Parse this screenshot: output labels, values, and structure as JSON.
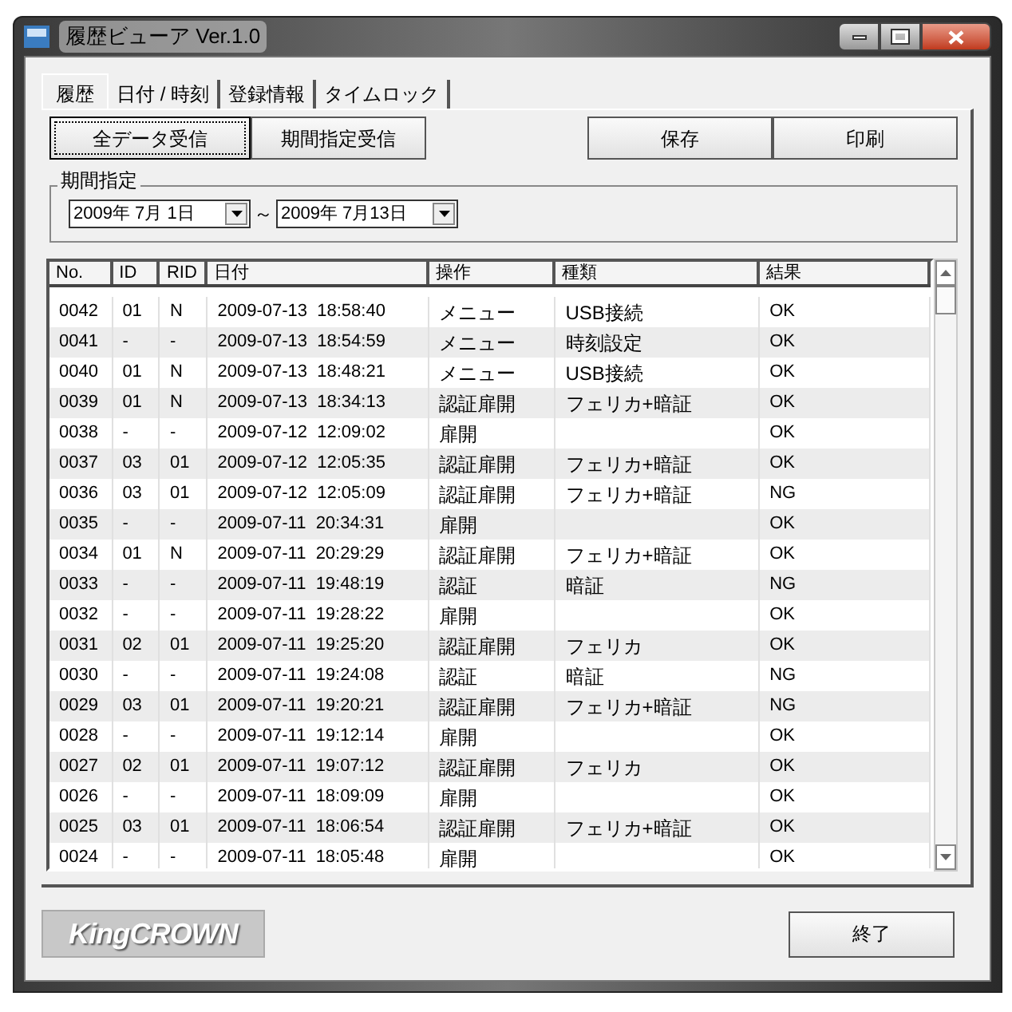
{
  "window": {
    "title": "履歴ビューア Ver.1.0"
  },
  "tabs": [
    {
      "label": "履歴",
      "selected": true
    },
    {
      "label": "日付 / 時刻",
      "selected": false
    },
    {
      "label": "登録情報",
      "selected": false
    },
    {
      "label": "タイムロック",
      "selected": false
    }
  ],
  "left_buttons": [
    {
      "label": "全データ受信",
      "selected": true
    },
    {
      "label": "期間指定受信",
      "selected": false
    }
  ],
  "right_buttons": [
    "保存",
    "印刷"
  ],
  "period": {
    "title": "期間指定",
    "from": "2009年 7月 1日",
    "separator": "～",
    "to": "2009年 7月13日"
  },
  "table": {
    "columns": [
      "No.",
      "ID",
      "RID",
      "日付",
      "操作",
      "種類",
      "結果"
    ],
    "rows": [
      [
        "0042",
        "01",
        "N",
        "2009-07-13  18:58:40",
        "メニュー",
        "USB接続",
        "OK"
      ],
      [
        "0041",
        "-",
        "-",
        "2009-07-13  18:54:59",
        "メニュー",
        "時刻設定",
        "OK"
      ],
      [
        "0040",
        "01",
        "N",
        "2009-07-13  18:48:21",
        "メニュー",
        "USB接続",
        "OK"
      ],
      [
        "0039",
        "01",
        "N",
        "2009-07-13  18:34:13",
        "認証扉開",
        "フェリカ+暗証",
        "OK"
      ],
      [
        "0038",
        "-",
        "-",
        "2009-07-12  12:09:02",
        "扉開",
        "",
        "OK"
      ],
      [
        "0037",
        "03",
        "01",
        "2009-07-12  12:05:35",
        "認証扉開",
        "フェリカ+暗証",
        "OK"
      ],
      [
        "0036",
        "03",
        "01",
        "2009-07-12  12:05:09",
        "認証扉開",
        "フェリカ+暗証",
        "NG"
      ],
      [
        "0035",
        "-",
        "-",
        "2009-07-11  20:34:31",
        "扉開",
        "",
        "OK"
      ],
      [
        "0034",
        "01",
        "N",
        "2009-07-11  20:29:29",
        "認証扉開",
        "フェリカ+暗証",
        "OK"
      ],
      [
        "0033",
        "-",
        "-",
        "2009-07-11  19:48:19",
        "認証",
        "暗証",
        "NG"
      ],
      [
        "0032",
        "-",
        "-",
        "2009-07-11  19:28:22",
        "扉開",
        "",
        "OK"
      ],
      [
        "0031",
        "02",
        "01",
        "2009-07-11  19:25:20",
        "認証扉開",
        "フェリカ",
        "OK"
      ],
      [
        "0030",
        "-",
        "-",
        "2009-07-11  19:24:08",
        "認証",
        "暗証",
        "NG"
      ],
      [
        "0029",
        "03",
        "01",
        "2009-07-11  19:20:21",
        "認証扉開",
        "フェリカ+暗証",
        "NG"
      ],
      [
        "0028",
        "-",
        "-",
        "2009-07-11  19:12:14",
        "扉開",
        "",
        "OK"
      ],
      [
        "0027",
        "02",
        "01",
        "2009-07-11  19:07:12",
        "認証扉開",
        "フェリカ",
        "OK"
      ],
      [
        "0026",
        "-",
        "-",
        "2009-07-11  18:09:09",
        "扉開",
        "",
        "OK"
      ],
      [
        "0025",
        "03",
        "01",
        "2009-07-11  18:06:54",
        "認証扉開",
        "フェリカ+暗証",
        "OK"
      ],
      [
        "0024",
        "-",
        "-",
        "2009-07-11  18:05:48",
        "扉開",
        "",
        "OK"
      ]
    ]
  },
  "logo": "KingCROWN",
  "close_button": "終了"
}
